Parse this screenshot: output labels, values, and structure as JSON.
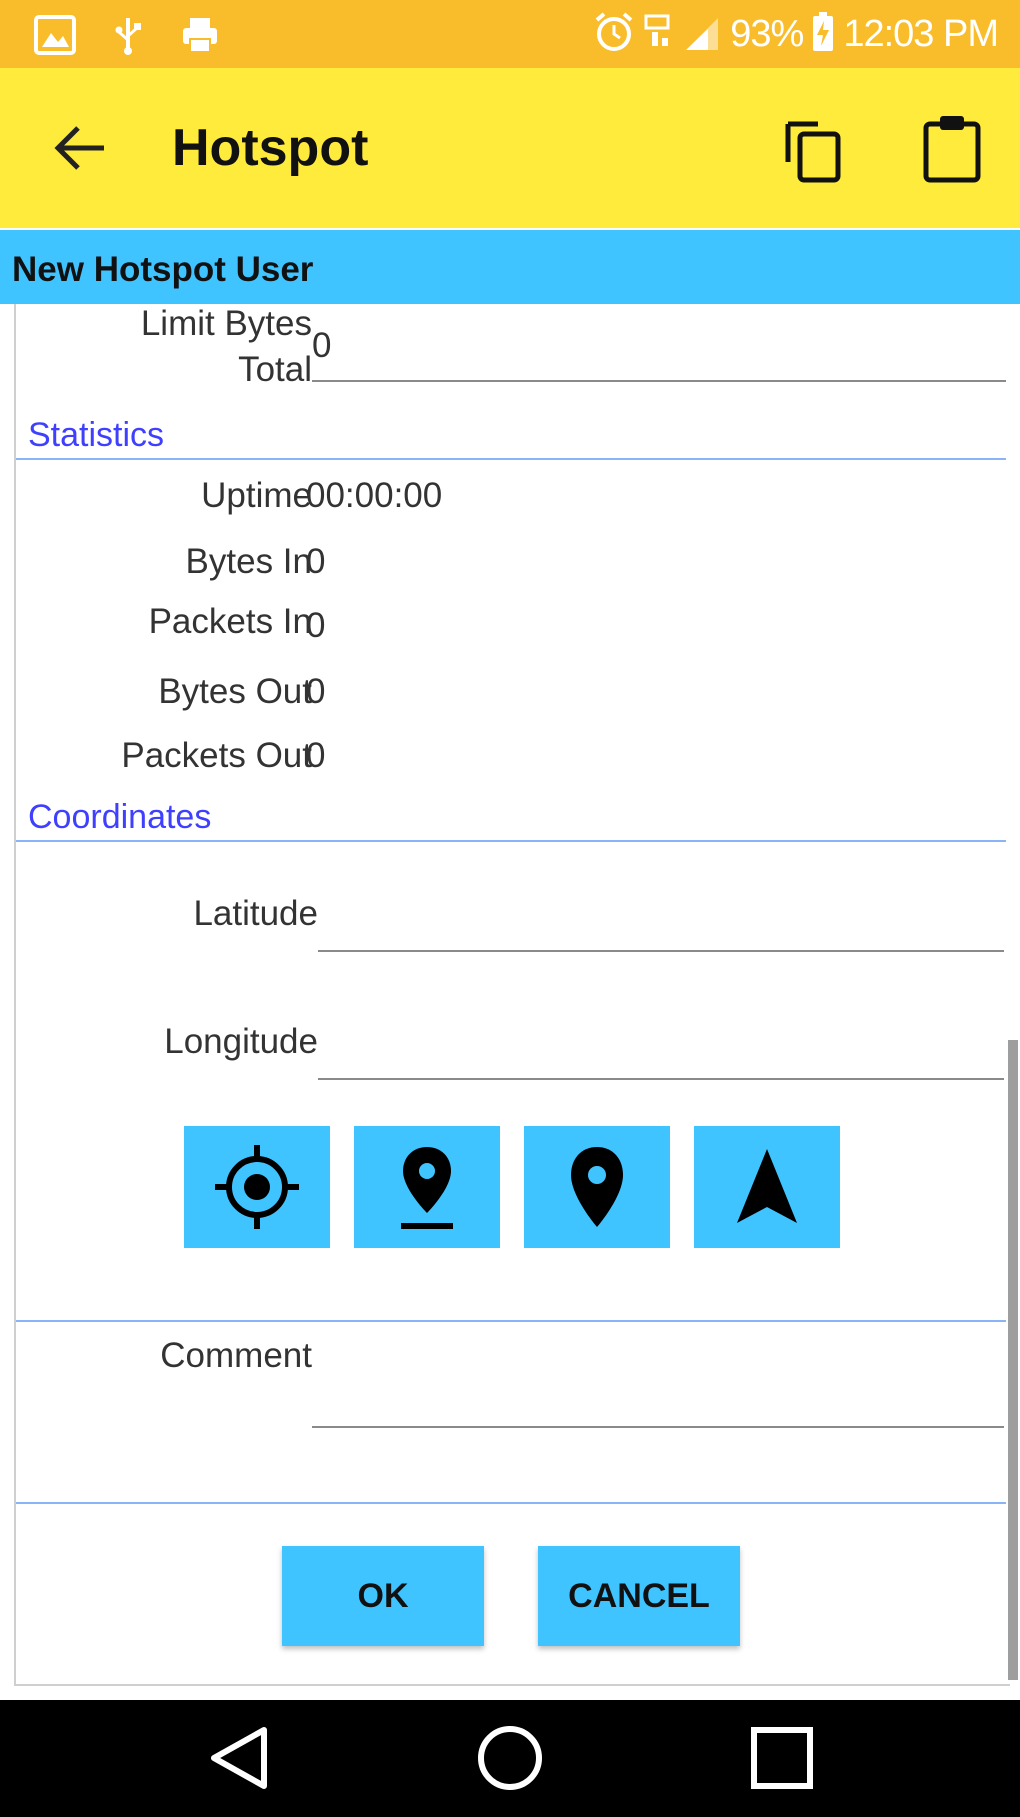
{
  "status_bar": {
    "left_icons": [
      "image-icon",
      "usb-icon",
      "print-icon"
    ],
    "right_icons": [
      "alarm-icon",
      "wifi-calling-icon",
      "signal-icon",
      "battery-charging-icon"
    ],
    "battery": "93%",
    "time": "12:03 PM"
  },
  "app_bar": {
    "title": "Hotspot",
    "icons": [
      "arrow-back-icon",
      "copy-icon",
      "clipboard-icon"
    ]
  },
  "subheader": {
    "label": "New Hotspot User"
  },
  "form": {
    "limit_bytes_total": {
      "label_line1": "Limit Bytes",
      "label_line2": "Total",
      "value": "0"
    },
    "statistics_title": "Statistics",
    "stats": [
      {
        "label": "Uptime",
        "value": "00:00:00"
      },
      {
        "label": "Bytes In",
        "value": "0"
      },
      {
        "label": "Packets In",
        "value": "0"
      },
      {
        "label": "Bytes Out",
        "value": "0"
      },
      {
        "label": "Packets Out",
        "value": "0"
      }
    ],
    "coordinates_title": "Coordinates",
    "latitude": {
      "label": "Latitude",
      "value": ""
    },
    "longitude": {
      "label": "Longitude",
      "value": ""
    },
    "coordinate_buttons": [
      "my-location-icon",
      "pin-drop-icon",
      "place-icon",
      "navigation-icon"
    ],
    "comment": {
      "label": "Comment",
      "value": ""
    }
  },
  "actions": {
    "ok": "OK",
    "cancel": "CANCEL"
  },
  "nav_bar": {
    "icons": [
      "back-triangle-icon",
      "home-circle-icon",
      "recents-square-icon"
    ]
  },
  "colors": {
    "status_bar": "#f9bd2c",
    "app_bar": "#ffeb3b",
    "accent": "#40c4ff",
    "section_title": "#3f3fff"
  }
}
